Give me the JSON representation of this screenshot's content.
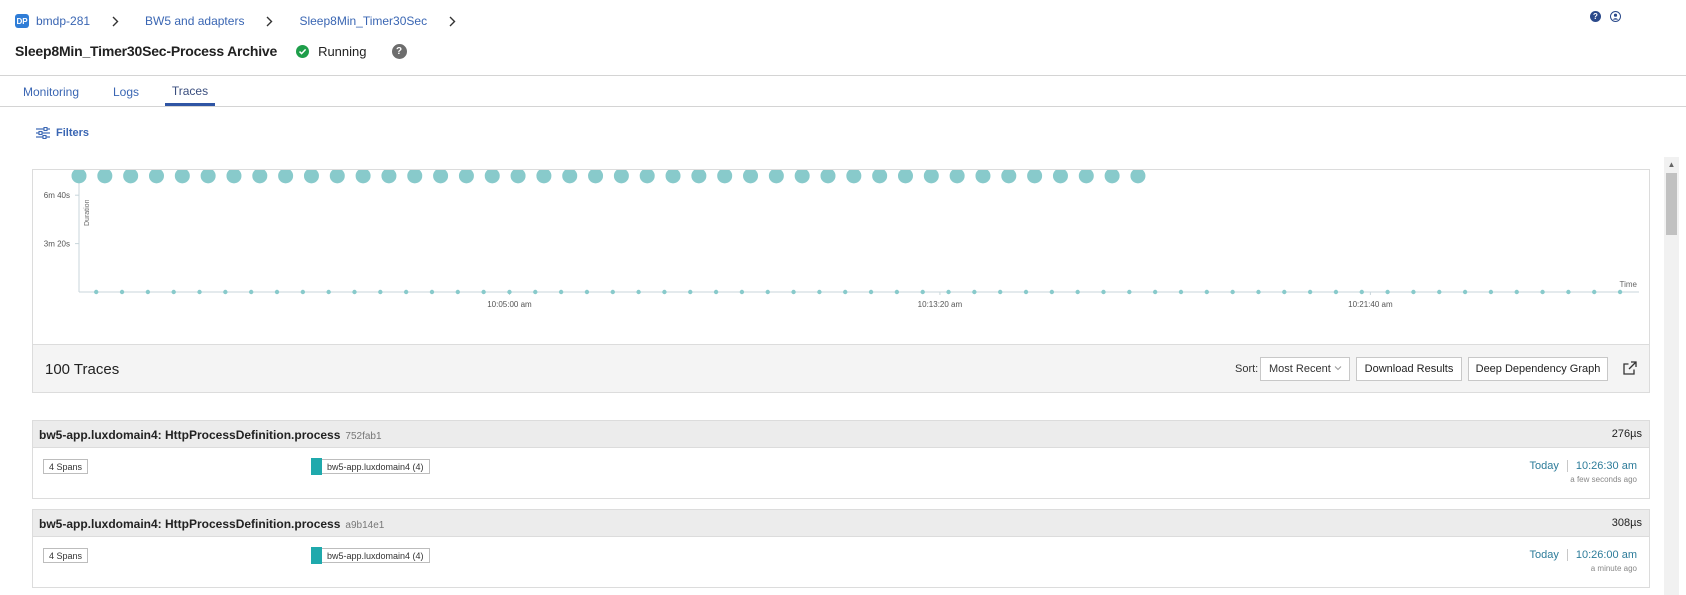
{
  "breadcrumb": {
    "badge": "DP",
    "items": [
      "bmdp-281",
      "BW5 and adapters",
      "Sleep8Min_Timer30Sec"
    ]
  },
  "header": {
    "title": "Sleep8Min_Timer30Sec-Process Archive",
    "status": "Running",
    "help_icon": "?",
    "right_icons": [
      "help-icon",
      "user-icon"
    ]
  },
  "tabs": [
    {
      "label": "Monitoring",
      "active": false
    },
    {
      "label": "Logs",
      "active": false
    },
    {
      "label": "Traces",
      "active": true
    }
  ],
  "filters": {
    "label": "Filters"
  },
  "chart_data": {
    "type": "scatter",
    "xlabel": "Time",
    "ylabel": "Duration",
    "y_tick_labels": [
      "6m 40s",
      "3m 20s"
    ],
    "y_ticks_seconds": [
      400,
      200
    ],
    "x_tick_labels": [
      "10:05:00 am",
      "10:13:20 am",
      "10:21:40 am"
    ],
    "x_ticks": [
      "10:05:00",
      "10:13:20",
      "10:21:40"
    ],
    "x_range": [
      "09:56:40",
      "10:26:52"
    ],
    "y_range_seconds": [
      0,
      500
    ],
    "colors": {
      "point": "#88cacb",
      "axis": "#c8d6db"
    },
    "series": [
      {
        "marker": "large",
        "x": [
          "09:56:40",
          "09:57:10",
          "09:57:40",
          "09:58:10",
          "09:58:40",
          "09:59:10",
          "09:59:40",
          "10:00:10",
          "10:00:40",
          "10:01:10",
          "10:01:40",
          "10:02:10",
          "10:02:40",
          "10:03:10",
          "10:03:40",
          "10:04:10",
          "10:04:40",
          "10:05:10",
          "10:05:40",
          "10:06:10",
          "10:06:40",
          "10:07:10",
          "10:07:40",
          "10:08:10",
          "10:08:40",
          "10:09:10",
          "10:09:40",
          "10:10:10",
          "10:10:40",
          "10:11:10",
          "10:11:40",
          "10:12:10",
          "10:12:40",
          "10:13:10",
          "10:13:40",
          "10:14:10",
          "10:14:40",
          "10:15:10",
          "10:15:40",
          "10:16:10",
          "10:16:40",
          "10:17:10"
        ],
        "y": [
          480,
          480,
          480,
          480,
          480,
          480,
          480,
          480,
          480,
          480,
          480,
          480,
          480,
          480,
          480,
          480,
          480,
          480,
          480,
          480,
          480,
          480,
          480,
          480,
          480,
          480,
          480,
          480,
          480,
          480,
          480,
          480,
          480,
          480,
          480,
          480,
          480,
          480,
          480,
          480,
          480,
          480
        ]
      },
      {
        "marker": "small",
        "x": [
          "09:57:00",
          "09:57:30",
          "09:58:00",
          "09:58:30",
          "09:59:00",
          "09:59:30",
          "10:00:00",
          "10:00:30",
          "10:01:00",
          "10:01:30",
          "10:02:00",
          "10:02:30",
          "10:03:00",
          "10:03:30",
          "10:04:00",
          "10:04:30",
          "10:05:00",
          "10:05:30",
          "10:06:00",
          "10:06:30",
          "10:07:00",
          "10:07:30",
          "10:08:00",
          "10:08:30",
          "10:09:00",
          "10:09:30",
          "10:10:00",
          "10:10:30",
          "10:11:00",
          "10:11:30",
          "10:12:00",
          "10:12:30",
          "10:13:00",
          "10:13:30",
          "10:14:00",
          "10:14:30",
          "10:15:00",
          "10:15:30",
          "10:16:00",
          "10:16:30",
          "10:17:00",
          "10:17:30",
          "10:18:00",
          "10:18:30",
          "10:19:00",
          "10:19:30",
          "10:20:00",
          "10:20:30",
          "10:21:00",
          "10:21:30",
          "10:22:00",
          "10:22:30",
          "10:23:00",
          "10:23:30",
          "10:24:00",
          "10:24:30",
          "10:25:00",
          "10:25:30",
          "10:26:00",
          "10:26:30"
        ],
        "y": [
          0,
          0,
          0,
          0,
          0,
          0,
          0,
          0,
          0,
          0,
          0,
          0,
          0,
          0,
          0,
          0,
          0,
          0,
          0,
          0,
          0,
          0,
          0,
          0,
          0,
          0,
          0,
          0,
          0,
          0,
          0,
          0,
          0,
          0,
          0,
          0,
          0,
          0,
          0,
          0,
          0,
          0,
          0,
          0,
          0,
          0,
          0,
          0,
          0,
          0,
          0,
          0,
          0,
          0,
          0,
          0,
          0,
          0,
          0,
          0
        ]
      }
    ]
  },
  "traces_bar": {
    "count_label": "100 Traces",
    "sort_label": "Sort:",
    "sort_value": "Most Recent",
    "download_label": "Download Results",
    "graph_label": "Deep Dependency Graph"
  },
  "traces": [
    {
      "name": "bw5-app.luxdomain4: HttpProcessDefinition.process",
      "id": "752fab1",
      "duration": "276µs",
      "spans": "4 Spans",
      "service": "bw5-app.luxdomain4 (4)",
      "day": "Today",
      "time": "10:26:30 am",
      "ago": "a few seconds ago"
    },
    {
      "name": "bw5-app.luxdomain4: HttpProcessDefinition.process",
      "id": "a9b14e1",
      "duration": "308µs",
      "spans": "4 Spans",
      "service": "bw5-app.luxdomain4 (4)",
      "day": "Today",
      "time": "10:26:00 am",
      "ago": "a minute ago"
    }
  ]
}
